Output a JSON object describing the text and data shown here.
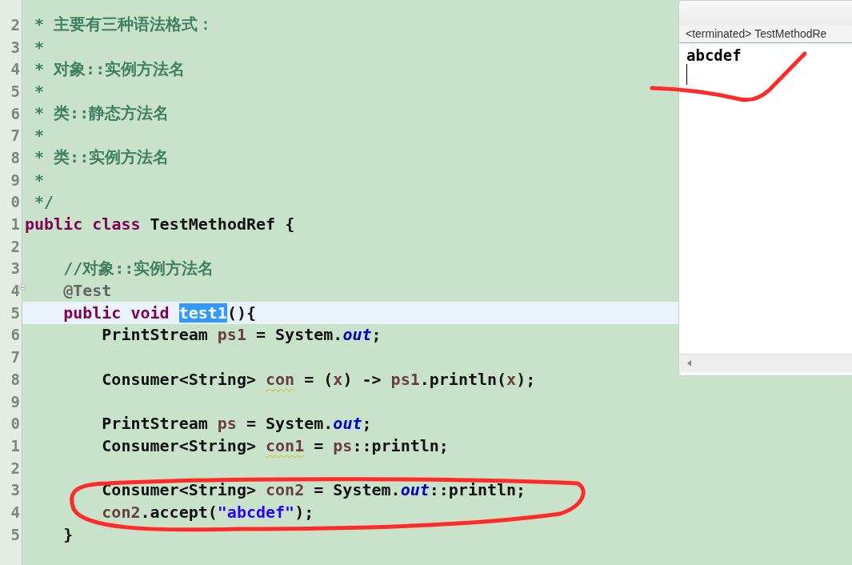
{
  "editor": {
    "lines": [
      {
        "number": "2",
        "current": false,
        "fold": false,
        "tokens": [
          {
            "text": " * 主要有三种语法格式：",
            "kind": "javadoc"
          }
        ]
      },
      {
        "number": "3",
        "current": false,
        "fold": false,
        "tokens": [
          {
            "text": " *",
            "kind": "javadoc"
          }
        ]
      },
      {
        "number": "4",
        "current": false,
        "fold": false,
        "tokens": [
          {
            "text": " * 对象::实例方法名",
            "kind": "javadoc"
          }
        ]
      },
      {
        "number": "5",
        "current": false,
        "fold": false,
        "tokens": [
          {
            "text": " *",
            "kind": "javadoc"
          }
        ]
      },
      {
        "number": "6",
        "current": false,
        "fold": false,
        "tokens": [
          {
            "text": " * 类::静态方法名",
            "kind": "javadoc"
          }
        ]
      },
      {
        "number": "7",
        "current": false,
        "fold": false,
        "tokens": [
          {
            "text": " *",
            "kind": "javadoc"
          }
        ]
      },
      {
        "number": "8",
        "current": false,
        "fold": false,
        "tokens": [
          {
            "text": " * 类::实例方法名",
            "kind": "javadoc"
          }
        ]
      },
      {
        "number": "9",
        "current": false,
        "fold": false,
        "tokens": [
          {
            "text": " *",
            "kind": "javadoc"
          }
        ]
      },
      {
        "number": "0",
        "current": false,
        "fold": false,
        "tokens": [
          {
            "text": " */",
            "kind": "javadoc"
          }
        ]
      },
      {
        "number": "1",
        "current": false,
        "fold": false,
        "tokens": [
          {
            "text": "public ",
            "kind": "keyword"
          },
          {
            "text": "class",
            "kind": "keyword"
          },
          {
            "text": " TestMethodRef {",
            "kind": "plain"
          }
        ]
      },
      {
        "number": "2",
        "current": false,
        "fold": false
      },
      {
        "number": "3",
        "current": false,
        "fold": false,
        "tokens": [
          {
            "text": "    //对象::实例方法名",
            "kind": "comment"
          }
        ]
      },
      {
        "number": "4",
        "current": false,
        "fold": true,
        "tokens": [
          {
            "text": "    @Test",
            "kind": "annotation"
          }
        ]
      },
      {
        "number": "5",
        "current": true,
        "fold": false,
        "tokens": [
          {
            "text": "    public ",
            "kind": "keyword"
          },
          {
            "text": "void ",
            "kind": "keyword"
          },
          {
            "text": "test1",
            "kind": "selected"
          },
          {
            "text": "(){",
            "kind": "plain"
          }
        ]
      },
      {
        "number": "6",
        "current": false,
        "fold": false,
        "tokens": [
          {
            "text": "        PrintStream ",
            "kind": "plain"
          },
          {
            "text": "ps1",
            "kind": "local"
          },
          {
            "text": " = System.",
            "kind": "plain"
          },
          {
            "text": "out",
            "kind": "field"
          },
          {
            "text": ";",
            "kind": "plain"
          }
        ]
      },
      {
        "number": "7",
        "current": false,
        "fold": false
      },
      {
        "number": "8",
        "current": false,
        "fold": false,
        "tokens": [
          {
            "text": "        Consumer<String> ",
            "kind": "plain"
          },
          {
            "text": "con",
            "kind": "warning"
          },
          {
            "text": " = (",
            "kind": "plain"
          },
          {
            "text": "x",
            "kind": "local"
          },
          {
            "text": ") -> ",
            "kind": "plain"
          },
          {
            "text": "ps1",
            "kind": "local"
          },
          {
            "text": ".println(",
            "kind": "plain"
          },
          {
            "text": "x",
            "kind": "local"
          },
          {
            "text": ");",
            "kind": "plain"
          }
        ]
      },
      {
        "number": "9",
        "current": false,
        "fold": false
      },
      {
        "number": "0",
        "current": false,
        "fold": false,
        "tokens": [
          {
            "text": "        PrintStream ",
            "kind": "plain"
          },
          {
            "text": "ps",
            "kind": "local"
          },
          {
            "text": " = System.",
            "kind": "plain"
          },
          {
            "text": "out",
            "kind": "field"
          },
          {
            "text": ";",
            "kind": "plain"
          }
        ]
      },
      {
        "number": "1",
        "current": false,
        "fold": false,
        "tokens": [
          {
            "text": "        Consumer<String> ",
            "kind": "plain"
          },
          {
            "text": "con1",
            "kind": "warning"
          },
          {
            "text": " = ",
            "kind": "plain"
          },
          {
            "text": "ps",
            "kind": "local"
          },
          {
            "text": "::println;",
            "kind": "plain"
          }
        ]
      },
      {
        "number": "2",
        "current": false,
        "fold": false
      },
      {
        "number": "3",
        "current": false,
        "fold": false,
        "tokens": [
          {
            "text": "        Consumer<String> ",
            "kind": "plain"
          },
          {
            "text": "con2",
            "kind": "local"
          },
          {
            "text": " = System.",
            "kind": "plain"
          },
          {
            "text": "out",
            "kind": "field"
          },
          {
            "text": "::println;",
            "kind": "plain"
          }
        ]
      },
      {
        "number": "4",
        "current": false,
        "fold": false,
        "tokens": [
          {
            "text": "        con2",
            "kind": "local"
          },
          {
            "text": ".accept(",
            "kind": "plain"
          },
          {
            "text": "\"abcdef\"",
            "kind": "string"
          },
          {
            "text": ");",
            "kind": "plain"
          }
        ]
      },
      {
        "number": "5",
        "current": false,
        "fold": false,
        "tokens": [
          {
            "text": "    }",
            "kind": "plain"
          }
        ]
      }
    ]
  },
  "console": {
    "header": "<terminated> TestMethodRe",
    "output": "abcdef"
  }
}
